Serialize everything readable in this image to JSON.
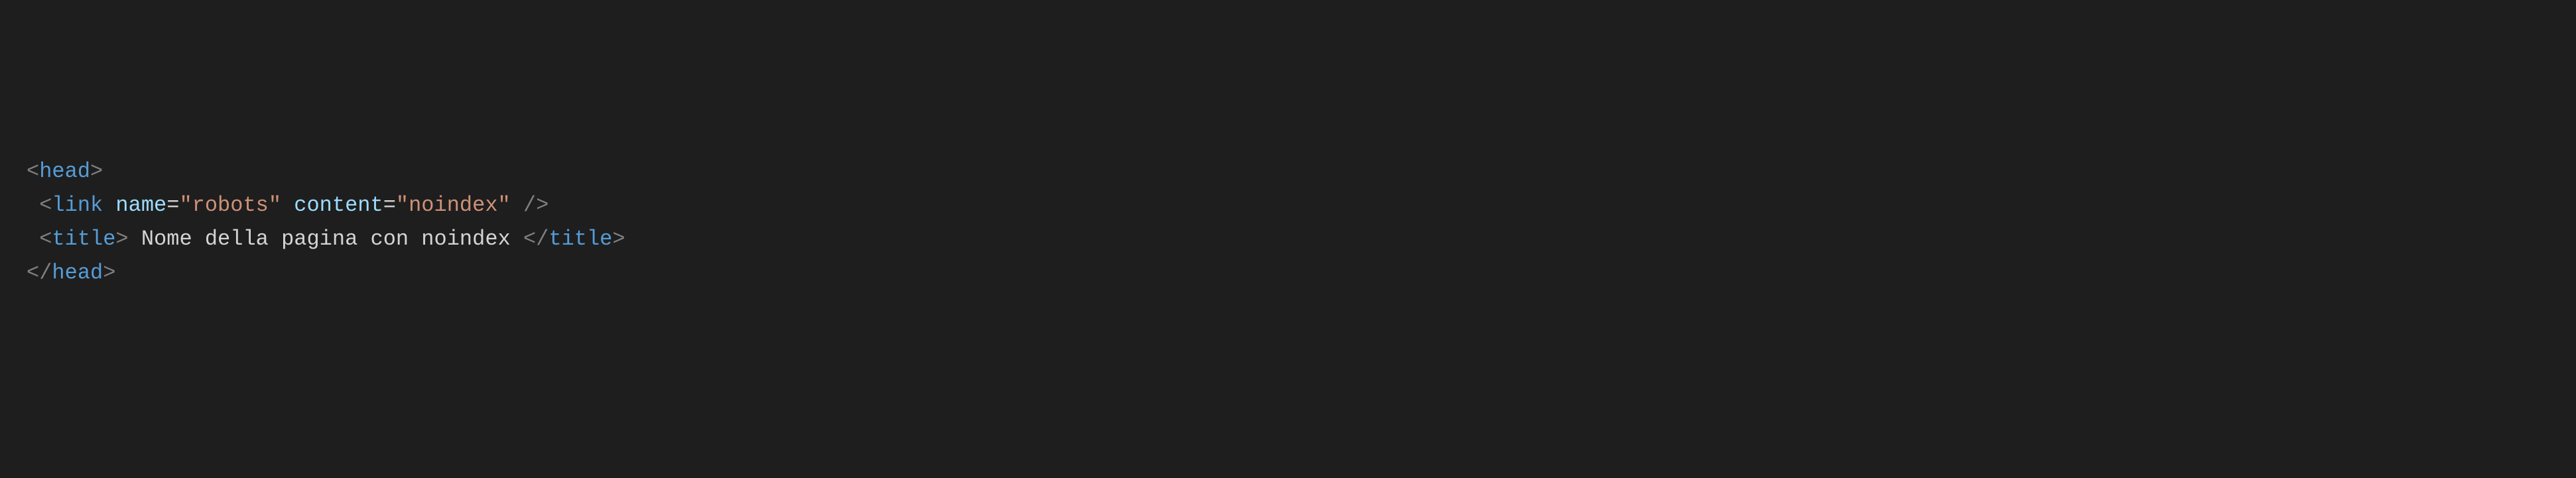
{
  "code": {
    "line1": {
      "bracket_open": "<",
      "tag": "head",
      "bracket_close": ">"
    },
    "line2": {
      "indent": " ",
      "bracket_open": "<",
      "tag": "link",
      "space1": " ",
      "attr1_name": "name",
      "equals1": "=",
      "attr1_value": "\"robots\"",
      "space2": " ",
      "attr2_name": "content",
      "equals2": "=",
      "attr2_value": "\"noindex\"",
      "space3": " ",
      "self_close": "/>"
    },
    "line3": {
      "indent": " ",
      "bracket_open": "<",
      "tag_open": "title",
      "bracket_close1": ">",
      "text": " Nome della pagina con noindex ",
      "bracket_open2": "</",
      "tag_close": "title",
      "bracket_close2": ">"
    },
    "line4": {
      "bracket_open": "</",
      "tag": "head",
      "bracket_close": ">"
    }
  }
}
